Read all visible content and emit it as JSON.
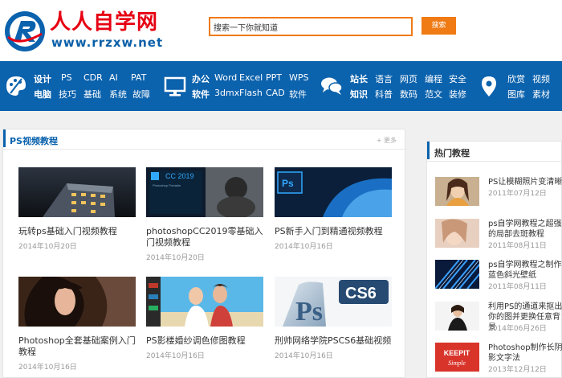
{
  "header": {
    "logo_cn": "人人自学网",
    "logo_en": "www.rrzxw.net",
    "search_placeholder": "搜索一下你就知道",
    "search_button": "搜索"
  },
  "nav": {
    "groups": [
      {
        "icon": "palette-icon",
        "top": [
          "设计",
          "PS",
          "CDR",
          "AI",
          "PAT"
        ],
        "bottom": [
          "电脑",
          "技巧",
          "基础",
          "系统",
          "故障"
        ]
      },
      {
        "icon": "monitor-icon",
        "top": [
          "办公",
          "Word",
          "Excel",
          "PPT",
          "WPS"
        ],
        "bottom": [
          "软件",
          "3dmx",
          "Flash",
          "CAD",
          "软件"
        ]
      },
      {
        "icon": "chat-icon",
        "top": [
          "站长",
          "语言",
          "网页",
          "编程",
          "安全"
        ],
        "bottom": [
          "知识",
          "科普",
          "数码",
          "范文",
          "装修"
        ]
      },
      {
        "icon": "location-pin-icon",
        "top": [
          "欣赏",
          "视频"
        ],
        "bottom": [
          "图库",
          "素材"
        ]
      }
    ]
  },
  "left_panel": {
    "title": "PS视频教程",
    "more": "更多",
    "cards": [
      {
        "title": "玩转ps基础入门视频教程",
        "date": "2014年10月20日"
      },
      {
        "title": "photoshopCC2019零基础入门视频教程",
        "date": "2014年10月20日"
      },
      {
        "title": "PS新手入门到精通视频教程",
        "date": "2014年10月16日"
      },
      {
        "title": "Photoshop全套基础案例入门教程",
        "date": "2014年10月16日"
      },
      {
        "title": "PS影楼婚纱调色修图教程",
        "date": "2014年10月16日"
      },
      {
        "title": "刑帅网络学院PSCS6基础视频",
        "date": "2014年10月16日"
      }
    ],
    "thumb_text": {
      "cc_label": "CC 2019",
      "ps_label": "Photoshop Portable",
      "ps_short": "Ps",
      "cs6": "CS6"
    }
  },
  "right_panel": {
    "title": "热门教程",
    "items": [
      {
        "title": "PS让模糊照片变清晰",
        "date": "2011年07月12日"
      },
      {
        "title": "ps自学网教程之超强的局部去斑教程",
        "date": "2011年08月11日"
      },
      {
        "title": "ps自学网教程之制作蓝色斜光壁纸",
        "date": "2011年08月11日"
      },
      {
        "title": "利用PS的通道来抠出你的图并更换任意背景",
        "date": "2014年06月26日"
      },
      {
        "title": "Photoshop制作长阴影文字法",
        "date": "2013年12月12日"
      }
    ],
    "keepit_text": "KEEPIT",
    "simple_text": "Simple"
  },
  "colors": {
    "brand_blue": "#0b62ad",
    "accent_orange": "#f07a14",
    "logo_red": "#e60012"
  }
}
